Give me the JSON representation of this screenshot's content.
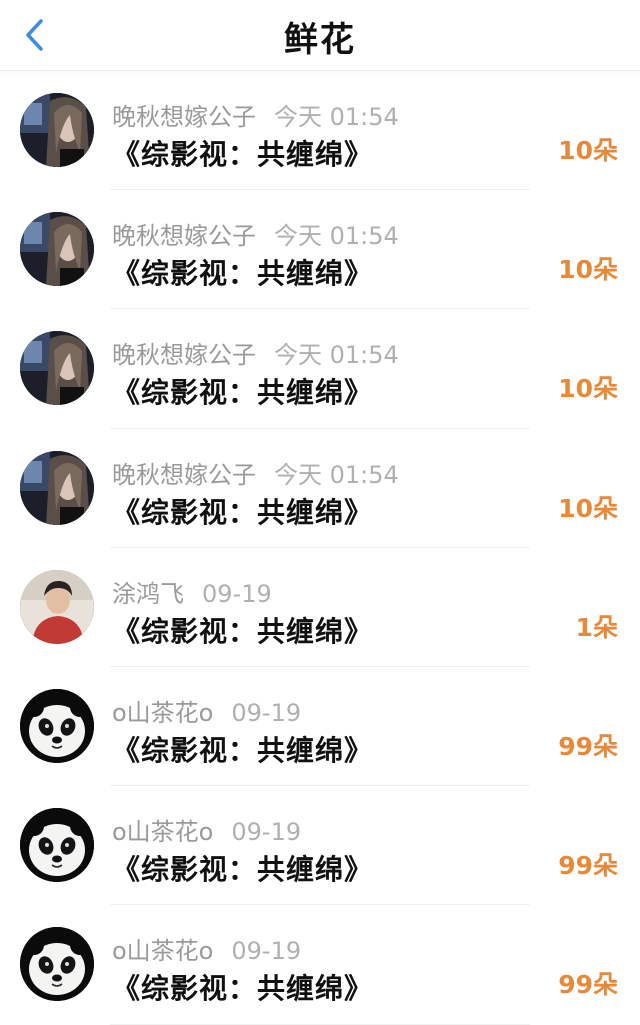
{
  "header": {
    "title": "鲜花",
    "back_icon": "chevron-left-icon",
    "accent_color": "#3b8ee8"
  },
  "count_color": "#e8893a",
  "rows": [
    {
      "avatar": "girl-portrait",
      "user": "晚秋想嫁公子",
      "time": "今天 01:54",
      "work": "《综影视：共缠绵》",
      "flowers": "10朵"
    },
    {
      "avatar": "girl-portrait",
      "user": "晚秋想嫁公子",
      "time": "今天 01:54",
      "work": "《综影视：共缠绵》",
      "flowers": "10朵"
    },
    {
      "avatar": "girl-portrait",
      "user": "晚秋想嫁公子",
      "time": "今天 01:54",
      "work": "《综影视：共缠绵》",
      "flowers": "10朵"
    },
    {
      "avatar": "girl-portrait",
      "user": "晚秋想嫁公子",
      "time": "今天 01:54",
      "work": "《综影视：共缠绵》",
      "flowers": "10朵"
    },
    {
      "avatar": "boy-portrait",
      "user": "涂鸿飞",
      "time": "09-19",
      "work": "《综影视：共缠绵》",
      "flowers": "1朵"
    },
    {
      "avatar": "panda",
      "user": "o山茶花o",
      "time": "09-19",
      "work": "《综影视：共缠绵》",
      "flowers": "99朵"
    },
    {
      "avatar": "panda",
      "user": "o山茶花o",
      "time": "09-19",
      "work": "《综影视：共缠绵》",
      "flowers": "99朵"
    },
    {
      "avatar": "panda",
      "user": "o山茶花o",
      "time": "09-19",
      "work": "《综影视：共缠绵》",
      "flowers": "99朵"
    }
  ]
}
